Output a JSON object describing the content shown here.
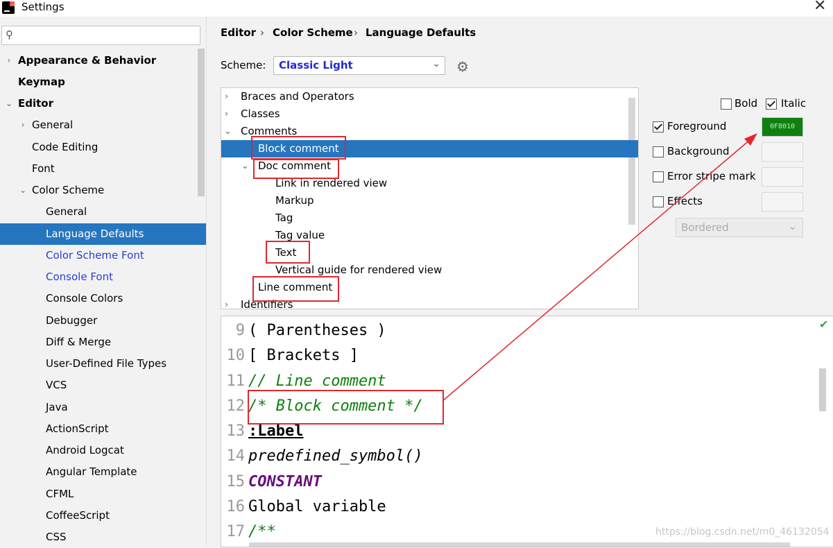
{
  "window": {
    "title": "Settings",
    "close_glyph": "✕"
  },
  "sidebar": {
    "search_placeholder": "",
    "items": [
      {
        "label": "Appearance & Behavior",
        "arrow": "›"
      },
      {
        "label": "Keymap",
        "arrow": ""
      },
      {
        "label": "Editor",
        "arrow": "⌄"
      },
      {
        "label": "General",
        "arrow": "›"
      },
      {
        "label": "Code Editing",
        "arrow": ""
      },
      {
        "label": "Font",
        "arrow": ""
      },
      {
        "label": "Color Scheme",
        "arrow": "⌄"
      },
      {
        "label": "General",
        "arrow": ""
      },
      {
        "label": "Language Defaults",
        "arrow": ""
      },
      {
        "label": "Color Scheme Font",
        "arrow": ""
      },
      {
        "label": "Console Font",
        "arrow": ""
      },
      {
        "label": "Console Colors",
        "arrow": ""
      },
      {
        "label": "Debugger",
        "arrow": ""
      },
      {
        "label": "Diff & Merge",
        "arrow": ""
      },
      {
        "label": "User-Defined File Types",
        "arrow": ""
      },
      {
        "label": "VCS",
        "arrow": ""
      },
      {
        "label": "Java",
        "arrow": ""
      },
      {
        "label": "ActionScript",
        "arrow": ""
      },
      {
        "label": "Android Logcat",
        "arrow": ""
      },
      {
        "label": "Angular Template",
        "arrow": ""
      },
      {
        "label": "CFML",
        "arrow": ""
      },
      {
        "label": "CoffeeScript",
        "arrow": ""
      },
      {
        "label": "CSS",
        "arrow": ""
      }
    ]
  },
  "breadcrumb": {
    "items": [
      "Editor",
      "Color Scheme",
      "Language Defaults"
    ],
    "separator": "›"
  },
  "scheme": {
    "label": "Scheme:",
    "value": "Classic Light",
    "chevron": "⌄",
    "gear_glyph": "⚙"
  },
  "tree": {
    "items": [
      {
        "label": "Braces and Operators",
        "chevron": "›"
      },
      {
        "label": "Classes",
        "chevron": "›"
      },
      {
        "label": "Comments",
        "chevron": "⌄"
      },
      {
        "label": "Block comment",
        "chevron": ""
      },
      {
        "label": "Doc comment",
        "chevron": "⌄"
      },
      {
        "label": "Link in rendered view",
        "chevron": ""
      },
      {
        "label": "Markup",
        "chevron": ""
      },
      {
        "label": "Tag",
        "chevron": ""
      },
      {
        "label": "Tag value",
        "chevron": ""
      },
      {
        "label": "Text",
        "chevron": ""
      },
      {
        "label": "Vertical guide for rendered view",
        "chevron": ""
      },
      {
        "label": "Line comment",
        "chevron": ""
      },
      {
        "label": "Identifiers",
        "chevron": "›"
      }
    ]
  },
  "attributes": {
    "bold": {
      "label": "Bold",
      "checked": false
    },
    "italic": {
      "label": "Italic",
      "checked": true
    },
    "foreground": {
      "label": "Foreground",
      "checked": true,
      "value": "0F8010"
    },
    "background": {
      "label": "Background",
      "checked": false
    },
    "error_stripe": {
      "label": "Error stripe mark",
      "checked": false
    },
    "effects": {
      "label": "Effects",
      "checked": false,
      "select_value": "Bordered",
      "chevron": "⌄"
    }
  },
  "editor": {
    "check_glyph": "✔",
    "lines": [
      {
        "num": "9",
        "code": "( Parentheses )"
      },
      {
        "num": "10",
        "code": "[ Brackets ]"
      },
      {
        "num": "11",
        "code": "// Line comment"
      },
      {
        "num": "12",
        "code": "/* Block comment */"
      },
      {
        "num": "13",
        "code": ":Label"
      },
      {
        "num": "14",
        "code": "predefined_symbol()"
      },
      {
        "num": "15",
        "code": "CONSTANT"
      },
      {
        "num": "16",
        "code": "Global variable"
      },
      {
        "num": "17",
        "code": "/**"
      }
    ]
  },
  "watermark": "https://blog.csdn.net/m0_46132054",
  "colors": {
    "selection": "#2675bf",
    "comment_green": "#0f8010",
    "constant_purple": "#660e7a",
    "link_blue": "#2c3bdc",
    "annotation_red": "#e0272f"
  }
}
